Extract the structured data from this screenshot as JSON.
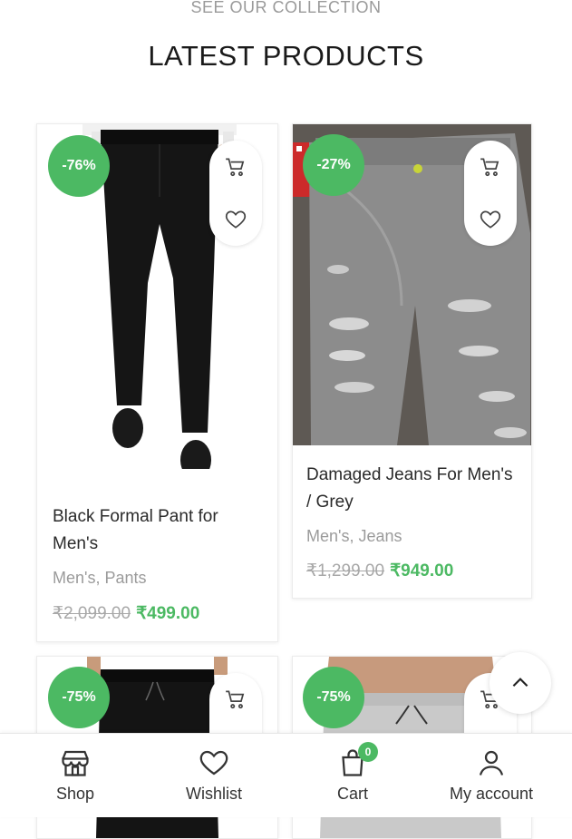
{
  "section": {
    "subtitle": "SEE OUR COLLECTION",
    "title": "LATEST PRODUCTS"
  },
  "products": [
    {
      "name": "Black Formal Pant for Men's",
      "category": "Men's, Pants",
      "old_price": "₹2,099.00",
      "new_price": "₹499.00",
      "discount": "-76%"
    },
    {
      "name": "Damaged Jeans For Men's / Grey",
      "category": "Men's, Jeans",
      "old_price": "₹1,299.00",
      "new_price": "₹949.00",
      "discount": "-27%"
    },
    {
      "discount": "-75%"
    },
    {
      "discount": "-75%"
    }
  ],
  "nav": {
    "shop": "Shop",
    "wishlist": "Wishlist",
    "cart": "Cart",
    "cart_count": "0",
    "account": "My account"
  },
  "colors": {
    "accent": "#4cb963",
    "old_price": "#a8a8a8"
  },
  "icons": [
    "cart-icon",
    "heart-icon",
    "chevron-up-icon",
    "store-icon",
    "bag-icon",
    "user-icon"
  ]
}
